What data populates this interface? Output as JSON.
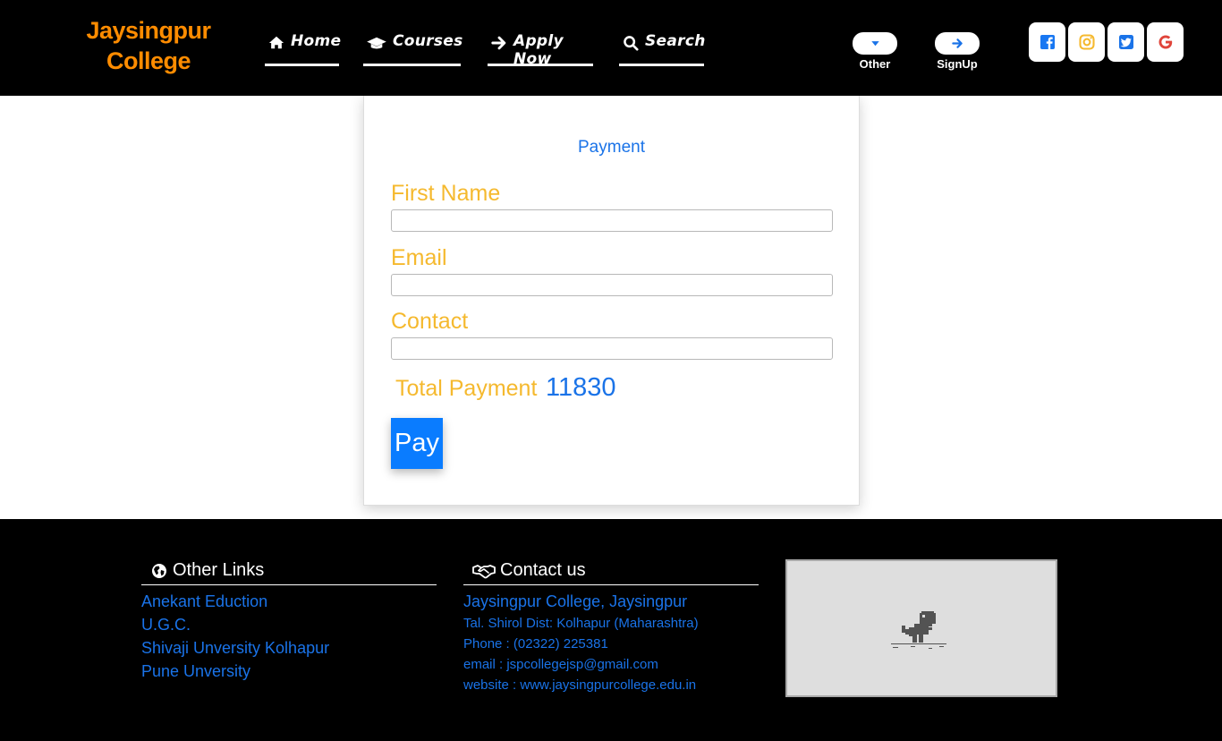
{
  "header": {
    "logo_line1": "Jaysingpur",
    "logo_line2": "College",
    "nav": [
      {
        "label": "Home",
        "icon": "home-icon"
      },
      {
        "label": "Courses",
        "icon": "graduation-cap-icon"
      },
      {
        "label": "Apply Now",
        "icon": "arrow-right-icon"
      },
      {
        "label": "Search",
        "icon": "search-icon"
      }
    ],
    "other_label": "Other",
    "signup_label": "SignUp",
    "social": [
      {
        "name": "facebook-icon",
        "color": "#1877f2"
      },
      {
        "name": "instagram-icon",
        "color": "#f5b92e"
      },
      {
        "name": "twitter-icon",
        "color": "#1a73e8"
      },
      {
        "name": "google-icon",
        "color": "#e0443a"
      }
    ]
  },
  "payment": {
    "title": "Payment",
    "first_name_label": "First Name",
    "first_name_value": "",
    "email_label": "Email",
    "email_value": "",
    "contact_label": "Contact",
    "contact_value": "",
    "total_label": "Total Payment",
    "total_value": "11830",
    "pay_label": "Pay"
  },
  "footer": {
    "links_heading": "Other Links",
    "links": [
      "Anekant Eduction",
      "U.G.C.",
      "Shivaji Unversity Kolhapur",
      "Pune Unversity"
    ],
    "contact_heading": "Contact us",
    "contact_main": "Jaysingpur College, Jaysingpur",
    "contact_lines": [
      "Tal. Shirol Dist: Kolhapur (Maharashtra)",
      "Phone : (02322) 225381",
      "email : jspcollegejsp@gmail.com",
      "website : www.jaysingpurcollege.edu.in"
    ],
    "map_icon": "dinosaur-icon"
  },
  "colors": {
    "accent_blue": "#1a73e8",
    "label_gold": "#f5b92e",
    "logo_orange": "#ff8c00",
    "pay_button": "#0a7cff"
  }
}
